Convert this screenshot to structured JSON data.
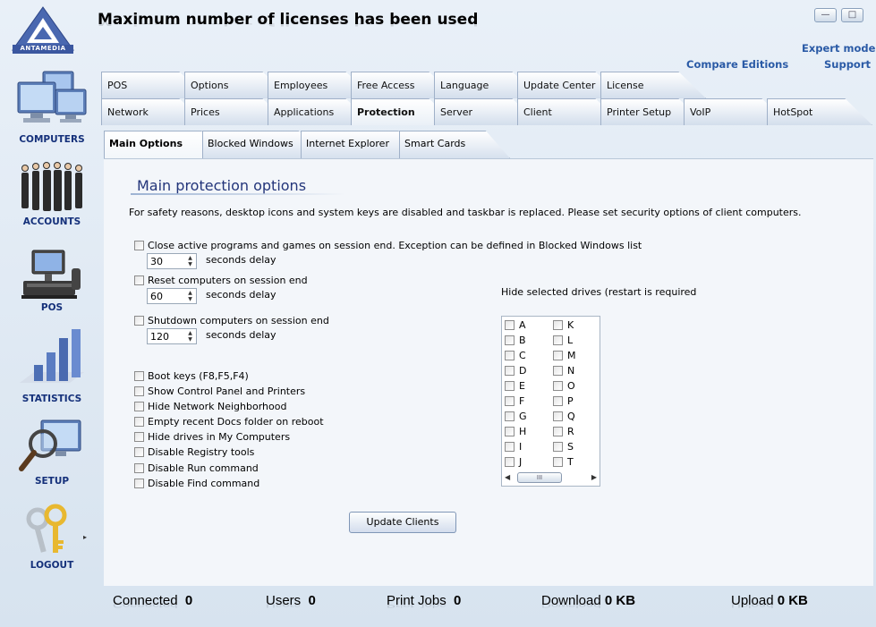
{
  "app": {
    "brand": "ANTAMEDIA",
    "title": "Maximum number of licenses has been used",
    "window_buttons": {
      "minimize": "—",
      "close": "□"
    }
  },
  "header_links": {
    "expert_mode": "Expert mode",
    "compare_editions": "Compare Editions",
    "support": "Support"
  },
  "sidebar": {
    "items": [
      {
        "label": "COMPUTERS",
        "icon": "computers-icon"
      },
      {
        "label": "ACCOUNTS",
        "icon": "accounts-icon"
      },
      {
        "label": "POS",
        "icon": "pos-icon"
      },
      {
        "label": "STATISTICS",
        "icon": "statistics-icon"
      },
      {
        "label": "SETUP",
        "icon": "setup-icon"
      },
      {
        "label": "LOGOUT",
        "icon": "logout-icon"
      }
    ],
    "more_arrow": "▸"
  },
  "tabs": {
    "row1": [
      "POS",
      "Options",
      "Employees",
      "Free Access",
      "Language",
      "Update Center",
      "License"
    ],
    "row2": [
      "Network",
      "Prices",
      "Applications",
      "Protection",
      "Server",
      "Client",
      "Printer Setup",
      "VoIP",
      "HotSpot"
    ],
    "active": "Protection"
  },
  "subtabs": {
    "items": [
      "Main Options",
      "Blocked Windows",
      "Internet Explorer",
      "Smart Cards"
    ],
    "active": "Main Options"
  },
  "main": {
    "section_title": "Main protection options",
    "description": "For safety reasons, desktop icons and system keys are disabled and taskbar is replaced. Please set security options of client computers.",
    "session_options": [
      {
        "label": "Close active programs and games on session end. Exception can be defined in Blocked Windows list",
        "checked": false,
        "delay": "30",
        "delay_label": "seconds delay"
      },
      {
        "label": "Reset computers on session end",
        "checked": false,
        "delay": "60",
        "delay_label": "seconds delay"
      },
      {
        "label": "Shutdown computers on session end",
        "checked": false,
        "delay": "120",
        "delay_label": "seconds delay"
      }
    ],
    "options": [
      {
        "label": "Boot keys (F8,F5,F4)",
        "checked": false
      },
      {
        "label": "Show Control Panel and Printers",
        "checked": false
      },
      {
        "label": "Hide Network Neighborhood",
        "checked": false
      },
      {
        "label": "Empty recent Docs folder on reboot",
        "checked": false
      },
      {
        "label": "Hide drives in My Computers",
        "checked": false
      },
      {
        "label": "Disable Registry tools",
        "checked": false
      },
      {
        "label": "Disable Run command",
        "checked": false
      },
      {
        "label": "Disable Find command",
        "checked": false
      }
    ],
    "drives": {
      "label": "Hide selected drives (restart is required",
      "col1": [
        "A",
        "B",
        "C",
        "D",
        "E",
        "F",
        "G",
        "H",
        "I",
        "J"
      ],
      "col2": [
        "K",
        "L",
        "M",
        "N",
        "O",
        "P",
        "Q",
        "R",
        "S",
        "T"
      ],
      "scroll_thumb": "III"
    },
    "update_button": "Update Clients"
  },
  "status": {
    "connected_label": "Connected",
    "connected_value": "0",
    "users_label": "Users",
    "users_value": "0",
    "print_jobs_label": "Print Jobs",
    "print_jobs_value": "0",
    "download_label": "Download",
    "download_value": "0 KB",
    "upload_label": "Upload",
    "upload_value": "0 KB"
  },
  "colors": {
    "accent": "#2a5aa6",
    "title_blue": "#23357a",
    "sidebar_label": "#14307a"
  }
}
